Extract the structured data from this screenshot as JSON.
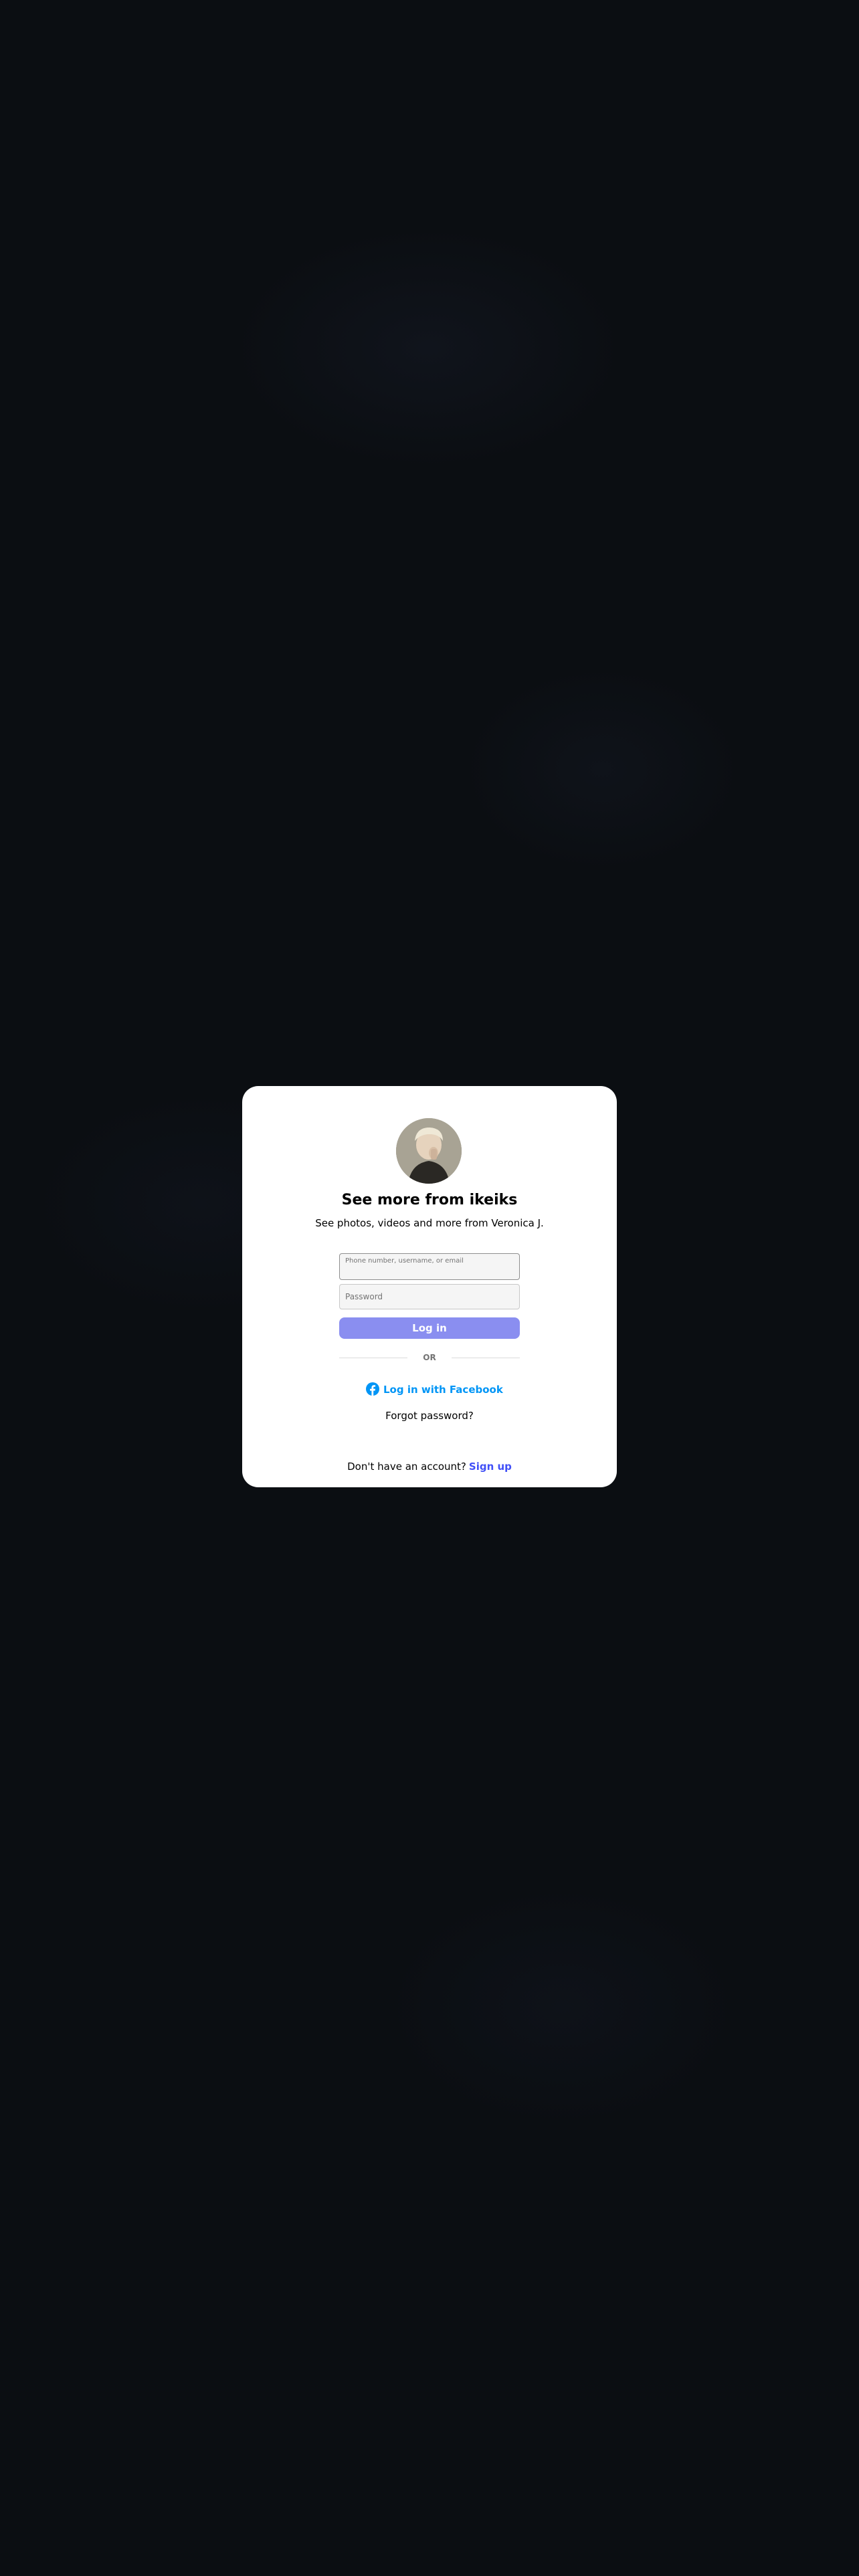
{
  "modal": {
    "title": "See more from ikeiks",
    "subtitle": "See photos, videos and more from Veronica J.",
    "phone_placeholder": "Phone number, username, or email",
    "password_placeholder": "Password",
    "login_label": "Log in",
    "divider_label": "OR",
    "facebook_login_label": "Log in with Facebook",
    "forgot_password_label": "Forgot password?",
    "no_account_text": "Don't have an account?",
    "signup_label": "Sign up"
  },
  "colors": {
    "background": "#0b0e12",
    "modal_background": "#ffffff",
    "login_button": "#8a8ef0",
    "facebook_blue": "#0095f6",
    "signup_link": "#4150f7"
  },
  "icons": {
    "facebook": "facebook-icon"
  }
}
